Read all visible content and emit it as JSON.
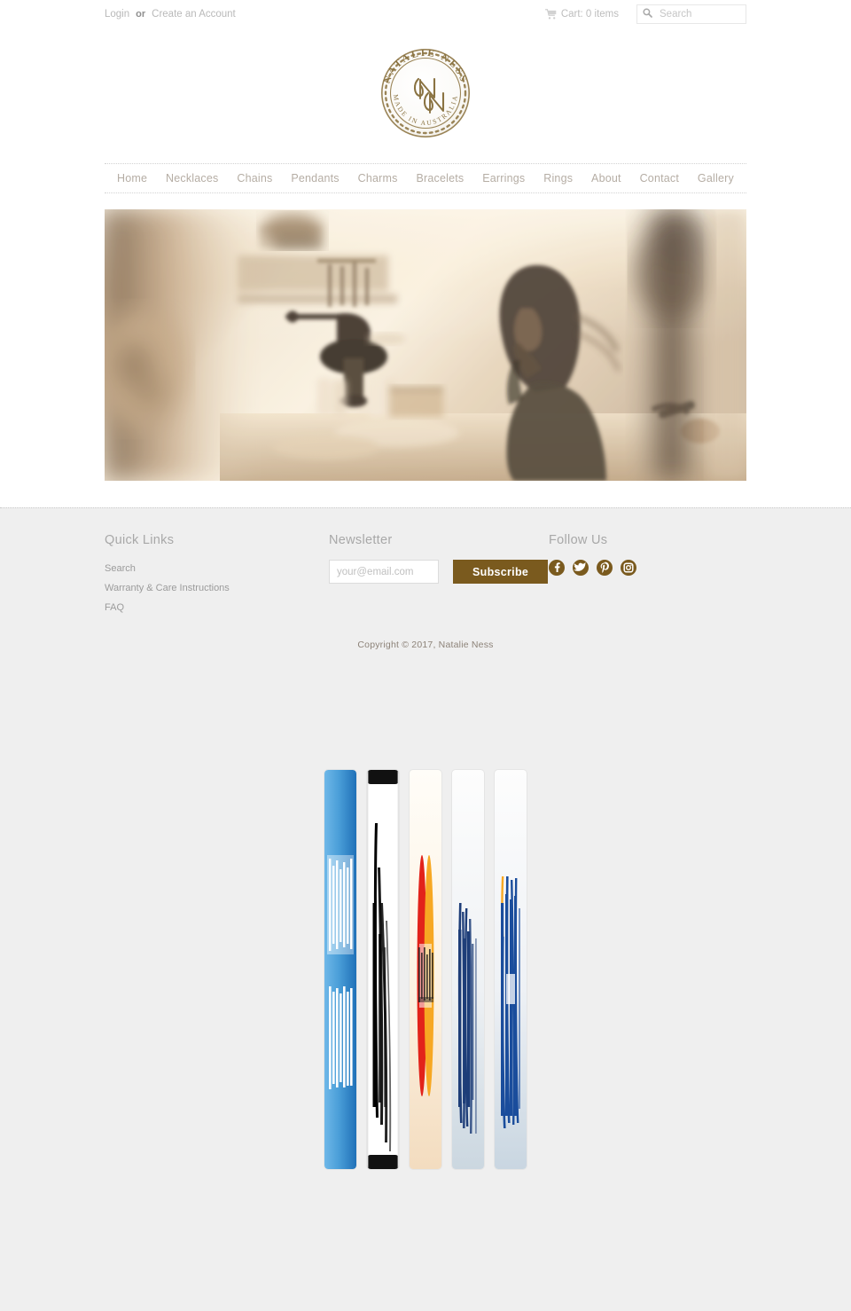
{
  "site": {
    "brand": "Natalie Ness",
    "logo_top_text": "NATALIE NESS",
    "logo_bottom_text": "MADE IN AUSTRALIA",
    "logo_monogram": "NN",
    "accent_brown": "#7a5a1e",
    "nav_text_color": "#b5ada4",
    "page_bg": "#efefef"
  },
  "utility": {
    "login_label": "Login",
    "or_label": "or",
    "create_account_label": "Create an Account",
    "cart_label": "Cart: 0 items",
    "cart_icon": "shopping-cart-icon",
    "search_icon": "search-icon",
    "search_value": "",
    "search_placeholder": "Search"
  },
  "nav": {
    "items": [
      {
        "label": "Home"
      },
      {
        "label": "Necklaces"
      },
      {
        "label": "Chains"
      },
      {
        "label": "Pendants"
      },
      {
        "label": "Charms"
      },
      {
        "label": "Bracelets"
      },
      {
        "label": "Earrings"
      },
      {
        "label": "Rings"
      },
      {
        "label": "About"
      },
      {
        "label": "Contact"
      },
      {
        "label": "Gallery"
      }
    ]
  },
  "hero": {
    "alt": "Jeweller working at a sunlit workbench, warm sepia tones"
  },
  "footer": {
    "quick_links": {
      "heading": "Quick Links",
      "items": [
        {
          "label": "Search"
        },
        {
          "label": "Warranty & Care Instructions"
        },
        {
          "label": "FAQ"
        }
      ]
    },
    "newsletter": {
      "heading": "Newsletter",
      "email_value": "",
      "email_placeholder": "your@email.com",
      "subscribe_label": "Subscribe"
    },
    "follow": {
      "heading": "Follow Us",
      "socials": [
        {
          "name": "facebook-icon",
          "label": "Facebook"
        },
        {
          "name": "twitter-icon",
          "label": "Twitter"
        },
        {
          "name": "pinterest-icon",
          "label": "Pinterest"
        },
        {
          "name": "instagram-icon",
          "label": "Instagram"
        }
      ]
    },
    "copyright": "Copyright © 2017, Natalie Ness"
  },
  "payment_methods": [
    {
      "name": "american-express-icon",
      "label": "American Express",
      "color": "#2e77bb"
    },
    {
      "name": "apple-pay-icon",
      "label": "Apple Pay",
      "color": "#000000"
    },
    {
      "name": "mastercard-icon",
      "label": "Mastercard",
      "color": "#e2231a"
    },
    {
      "name": "paypal-icon",
      "label": "PayPal",
      "color": "#1d3d78"
    },
    {
      "name": "visa-icon",
      "label": "Visa",
      "color": "#1a4d9c"
    }
  ]
}
